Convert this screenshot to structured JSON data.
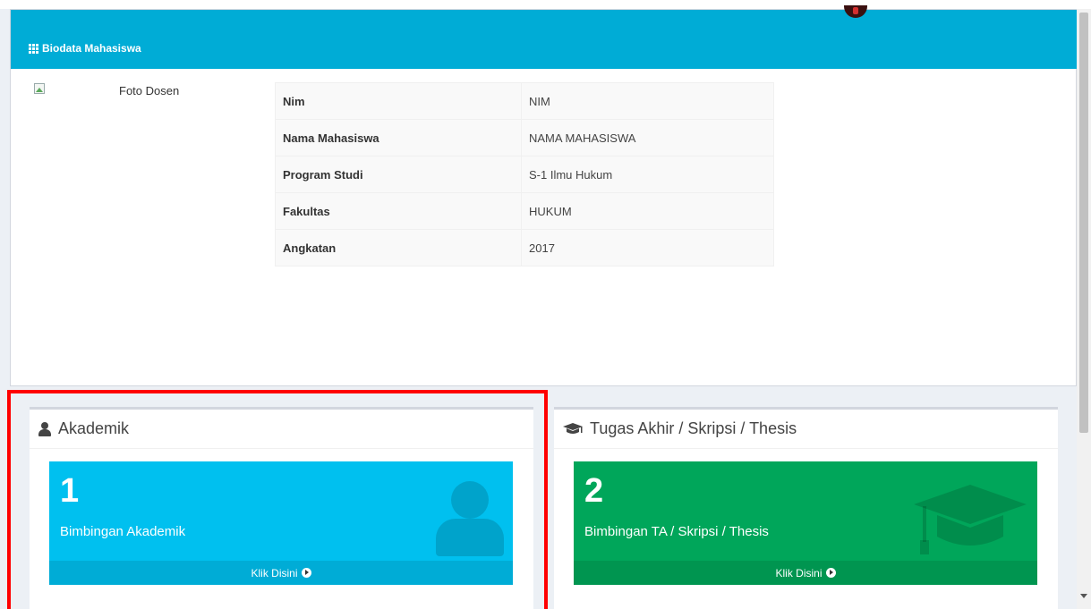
{
  "biodata": {
    "title": "Biodata Mahasiswa",
    "photo_alt": "Foto Dosen",
    "rows": [
      {
        "label": "Nim",
        "value": "NIM"
      },
      {
        "label": "Nama Mahasiswa",
        "value": "NAMA MAHASISWA"
      },
      {
        "label": "Program Studi",
        "value": "S-1 Ilmu Hukum"
      },
      {
        "label": "Fakultas",
        "value": "HUKUM"
      },
      {
        "label": "Angkatan",
        "value": "2017"
      }
    ]
  },
  "akademik": {
    "title": "Akademik",
    "count": "1",
    "label": "Bimbingan Akademik",
    "link": "Klik Disini",
    "color": "#00c0ef"
  },
  "tugas_akhir": {
    "title": "Tugas Akhir / Skripsi / Thesis",
    "count": "2",
    "label": "Bimbingan TA / Skripsi / Thesis",
    "link": "Klik Disini",
    "color": "#00a65a"
  },
  "colors": {
    "header": "#00acd6",
    "highlight": "#ff0000"
  }
}
